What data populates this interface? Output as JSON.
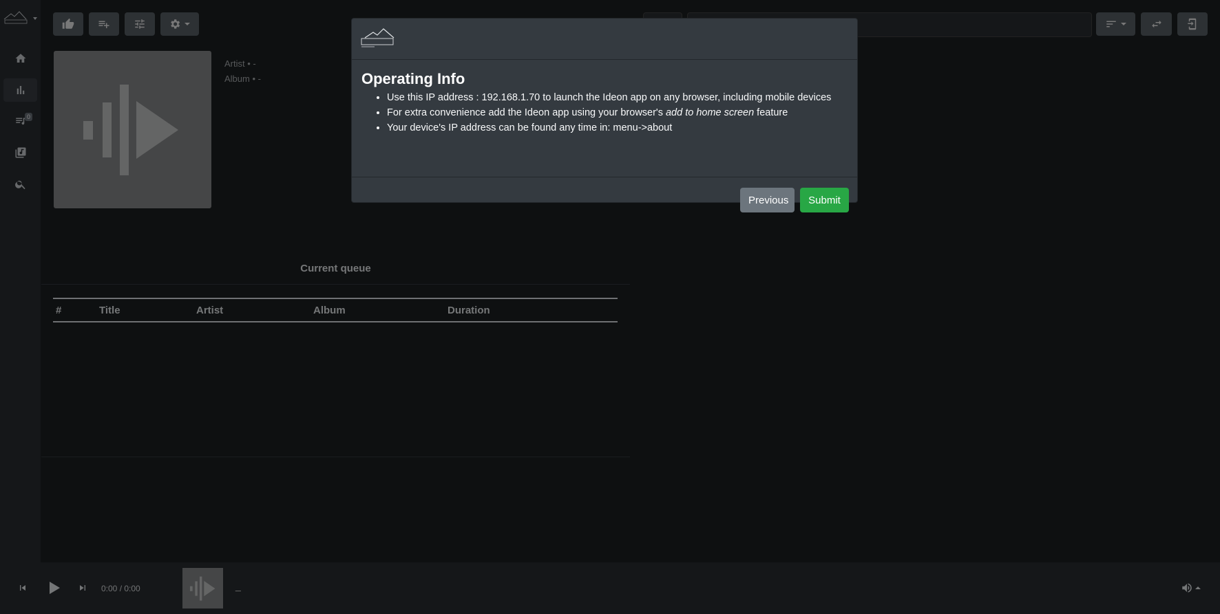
{
  "sidebar": {
    "badge_count": "0",
    "items": [
      {
        "name": "home-icon"
      },
      {
        "name": "bar-chart-icon",
        "active": true
      },
      {
        "name": "queue-icon"
      },
      {
        "name": "library-icon"
      },
      {
        "name": "search-icon"
      }
    ]
  },
  "now_playing": {
    "artist_label": "Artist",
    "artist_value": "• -",
    "album_label": "Album",
    "album_value": "• -"
  },
  "queue": {
    "title": "Current queue",
    "columns": [
      "#",
      "Title",
      "Artist",
      "Album",
      "Duration"
    ]
  },
  "player": {
    "time": "0:00 / 0:00",
    "track": "_"
  },
  "modal": {
    "title": "Operating Info",
    "item1": "Use this IP address : 192.168.1.70 to launch the Ideon app on any browser, including mobile devices",
    "item2_pre": "For extra convenience add the Ideon app using your browser's ",
    "item2_em": "add to home screen",
    "item2_post": " feature",
    "item3": "Your device's IP address can be found any time in: menu->about",
    "previous_label": "Previous",
    "submit_label": "Submit"
  },
  "colors": {
    "success": "#28a745",
    "secondary": "#6c757d",
    "modal_bg": "#343a40"
  }
}
